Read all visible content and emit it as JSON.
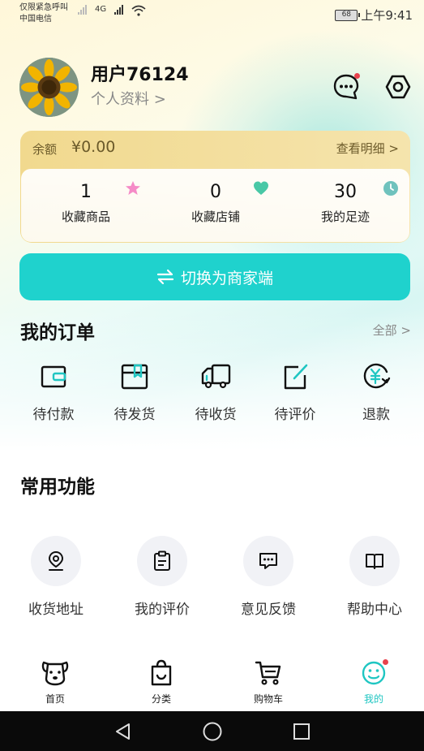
{
  "status_bar": {
    "line1": "仅限紧急呼叫",
    "line2": "中国电信",
    "network": "4G",
    "battery": "68",
    "time": "上午9:41"
  },
  "profile": {
    "username": "用户76124",
    "profile_link": "个人资料 >",
    "message_icon": "message-dots-icon",
    "settings_icon": "hexagon-settings-icon"
  },
  "balance": {
    "label": "余额",
    "amount": "¥0.00",
    "detail_link": "查看明细 >"
  },
  "stats": [
    {
      "value": "1",
      "label": "收藏商品",
      "icon": "star-icon",
      "color": "#f58bc7"
    },
    {
      "value": "0",
      "label": "收藏店铺",
      "icon": "heart-icon",
      "color": "#49c8a6"
    },
    {
      "value": "30",
      "label": "我的足迹",
      "icon": "clock-icon",
      "color": "#6fc2bd"
    }
  ],
  "switch_button": {
    "label": "切换为商家端",
    "icon": "swap-arrows-icon",
    "color": "#1fd2cd"
  },
  "orders": {
    "title": "我的订单",
    "all_link": "全部 >",
    "items": [
      {
        "label": "待付款",
        "icon": "wallet-icon"
      },
      {
        "label": "待发货",
        "icon": "package-icon"
      },
      {
        "label": "待收货",
        "icon": "truck-icon"
      },
      {
        "label": "待评价",
        "icon": "edit-icon"
      },
      {
        "label": "退款",
        "icon": "refund-icon"
      }
    ]
  },
  "functions": {
    "title": "常用功能",
    "items": [
      {
        "label": "收货地址",
        "icon": "location-pin-icon"
      },
      {
        "label": "我的评价",
        "icon": "clipboard-icon"
      },
      {
        "label": "意见反馈",
        "icon": "feedback-icon"
      },
      {
        "label": "帮助中心",
        "icon": "book-icon"
      }
    ]
  },
  "tab_bar": {
    "tabs": [
      {
        "label": "首页",
        "icon": "dog-face-icon"
      },
      {
        "label": "分类",
        "icon": "shopping-bag-icon"
      },
      {
        "label": "购物车",
        "icon": "cart-icon"
      },
      {
        "label": "我的",
        "icon": "smiley-icon",
        "active": true
      }
    ],
    "accent": "#1fc6c2"
  }
}
